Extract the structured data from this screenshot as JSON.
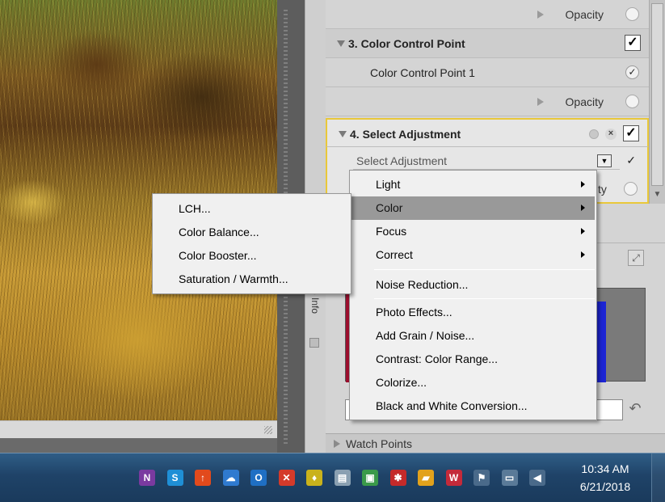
{
  "panel": {
    "rows": [
      {
        "kind": "opacity",
        "label": "Opacity"
      },
      {
        "kind": "section",
        "label": "3. Color Control Point"
      },
      {
        "kind": "sub",
        "label": "Color Control Point 1",
        "check": "✓"
      },
      {
        "kind": "opacity",
        "label": "Opacity"
      }
    ],
    "active_section": {
      "label": "4. Select Adjustment",
      "close": "×",
      "check": "✓"
    },
    "select": {
      "value": "Select Adjustment",
      "dropdown": "▼",
      "check": "✓"
    },
    "hidden_row": {
      "label": "ty"
    },
    "section_check": "✓",
    "side_label": "o Info",
    "watch_points": "Watch Points",
    "undo_icon": "↶",
    "expand_icon": "⤢"
  },
  "main_menu": {
    "items": [
      {
        "label": "Light",
        "submenu": true
      },
      {
        "label": "Color",
        "submenu": true,
        "highlighted": true
      },
      {
        "label": "Focus",
        "submenu": true
      },
      {
        "label": "Correct",
        "submenu": true
      },
      {
        "label": "Noise Reduction...",
        "submenu": false
      },
      {
        "label": "Photo Effects...",
        "submenu": false
      },
      {
        "label": "Add Grain / Noise...",
        "submenu": false
      },
      {
        "label": "Contrast: Color Range...",
        "submenu": false
      },
      {
        "label": "Colorize...",
        "submenu": false
      },
      {
        "label": "Black and White Conversion...",
        "submenu": false
      }
    ]
  },
  "sub_menu": {
    "items": [
      {
        "label": "LCH..."
      },
      {
        "label": "Color Balance..."
      },
      {
        "label": "Color Booster..."
      },
      {
        "label": "Saturation / Warmth..."
      }
    ]
  },
  "taskbar": {
    "tray_icons": [
      {
        "name": "nik-icon",
        "glyph": "N",
        "color": "#7a3aa0"
      },
      {
        "name": "skype-icon",
        "glyph": "S",
        "color": "#1f8fd6"
      },
      {
        "name": "update-icon",
        "glyph": "↑",
        "color": "#e24a1c"
      },
      {
        "name": "cloud-icon",
        "glyph": "☁",
        "color": "#2f7ad0"
      },
      {
        "name": "outlook-icon",
        "glyph": "O",
        "color": "#1f6fc4"
      },
      {
        "name": "tools-icon",
        "glyph": "✕",
        "color": "#d43a2a"
      },
      {
        "name": "shield-icon",
        "glyph": "♦",
        "color": "#c9b21c"
      },
      {
        "name": "drive-icon",
        "glyph": "▤",
        "color": "#8aa0b2"
      },
      {
        "name": "monitor-icon",
        "glyph": "▣",
        "color": "#3a9a4a"
      },
      {
        "name": "virus-icon",
        "glyph": "✱",
        "color": "#c42a2a"
      },
      {
        "name": "folder-icon",
        "glyph": "▰",
        "color": "#e2a21c"
      },
      {
        "name": "antivirus-icon",
        "glyph": "W",
        "color": "#c42a3a"
      },
      {
        "name": "flag-icon",
        "glyph": "⚑",
        "color": "#4a6a8a"
      },
      {
        "name": "network-icon",
        "glyph": "▭",
        "color": "#5a7a98"
      },
      {
        "name": "volume-icon",
        "glyph": "◀",
        "color": "#4a6a8a"
      }
    ],
    "time": "10:34 AM",
    "date": "6/21/2018"
  }
}
